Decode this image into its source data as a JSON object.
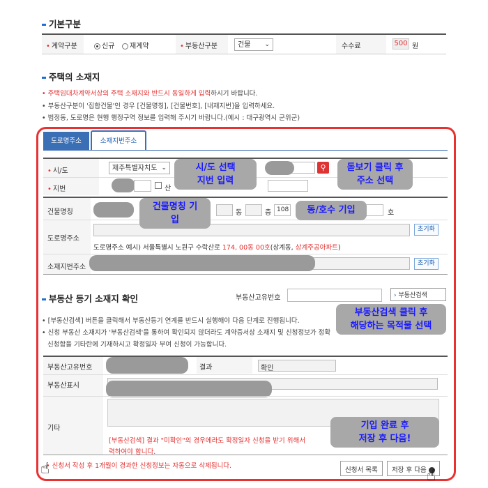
{
  "section_contract": {
    "title": "기본구분",
    "contract_type_label": "계약구분",
    "contract_options": [
      "신규",
      "재계약"
    ],
    "property_type_label": "부동산구분",
    "property_type_value": "건물",
    "fee_label": "수수료",
    "fee_value": "500",
    "fee_unit": "원"
  },
  "section_location": {
    "title": "주택의 소재지",
    "notes": [
      "주택임대차계약서상의 주택 소재지와 반드시 동일하게 입력하시기 바랍니다.",
      "부동산구분이 '집합건물'인 경우 [건물명칭], [건물번호], [내재지번]을 입력하세요.",
      "법정동, 도로명은 현행 행정구역 정보를 입력해 주시기 바랍니다.(예시 : 대구광역시 군위군)"
    ],
    "note1_red": "주택임대차계약서상의 주택 소재지와 반드시 동일하게 입력",
    "note1_rest": "하시기 바랍니다.",
    "tabs": [
      "도로명주소",
      "소재지번주소"
    ],
    "sido_label": "시/도",
    "sido_value": "제주특별자치도",
    "jibun_label": "지번",
    "mountain_label": "산",
    "building_name_label": "건물명칭",
    "dong_suffix": "동",
    "floor_suffix": "층",
    "floor_value": "108",
    "unit_prefix": "호",
    "road_addr_label": "도로명주소",
    "reset_label": "초기화",
    "road_example_prefix": "도로명주소 예시) 서울특별시 노원구 수락산로 ",
    "road_example_num": "174, 00동 00호",
    "road_example_mid": "(상계동, ",
    "road_example_apt": "상계주공아파트",
    "road_example_end": ")",
    "lot_addr_label": "소재지번주소"
  },
  "section_registry": {
    "title": "부동산 등기 소재지 확인",
    "unique_no_label": "부동산고유번호",
    "search_button": "부동산검색",
    "notes": [
      "[부동산검색] 버튼을 클릭해서 부동산등기 연계를 반드시 실행해야 다음 단계로 진행됩니다.",
      "신청 부동산 소재지가 '부동산검색'을 통하여 확인되지 않더라도 계약증서상 소재지 및 신청정보가 정확",
      "신청함을 기타란에 기재하시고 확정일자 부여 신청이 가능합니다."
    ],
    "table_unique_label": "부동산고유번호",
    "result_label": "결과",
    "result_value": "확인",
    "display_label": "부동산표시",
    "etc_label": "기타",
    "etc_red_text_1": "[부동산검색] 결과 \"미확인\"의 경우에라도 확정일자 신청을 받기 위해서",
    "etc_red_text_2": "력하여야 합니다."
  },
  "footer": {
    "warning": "신청서 작성 후 1개월이 경과한 신청정보는 자동으로 삭제됩니다.",
    "list_button": "신청서 목록",
    "next_button": "저장 후 다음"
  },
  "callouts": {
    "c1": [
      "시/도 선택",
      "지번 입력"
    ],
    "c2": [
      "돋보기 클릭 후",
      "주소 선택"
    ],
    "c3": [
      "건물명칭 기",
      "입"
    ],
    "c4": "동/호수 기입",
    "c5": [
      "부동산검색 클릭 후",
      "해당하는 목적물 선택"
    ],
    "c6": [
      "기입 완료 후",
      "저장 후 다음!"
    ]
  },
  "colors": {
    "accent": "#1e6fd0",
    "tab_active": "#3b6fb5",
    "highlight_border": "#e83232",
    "callout_text": "#1a1aff"
  }
}
